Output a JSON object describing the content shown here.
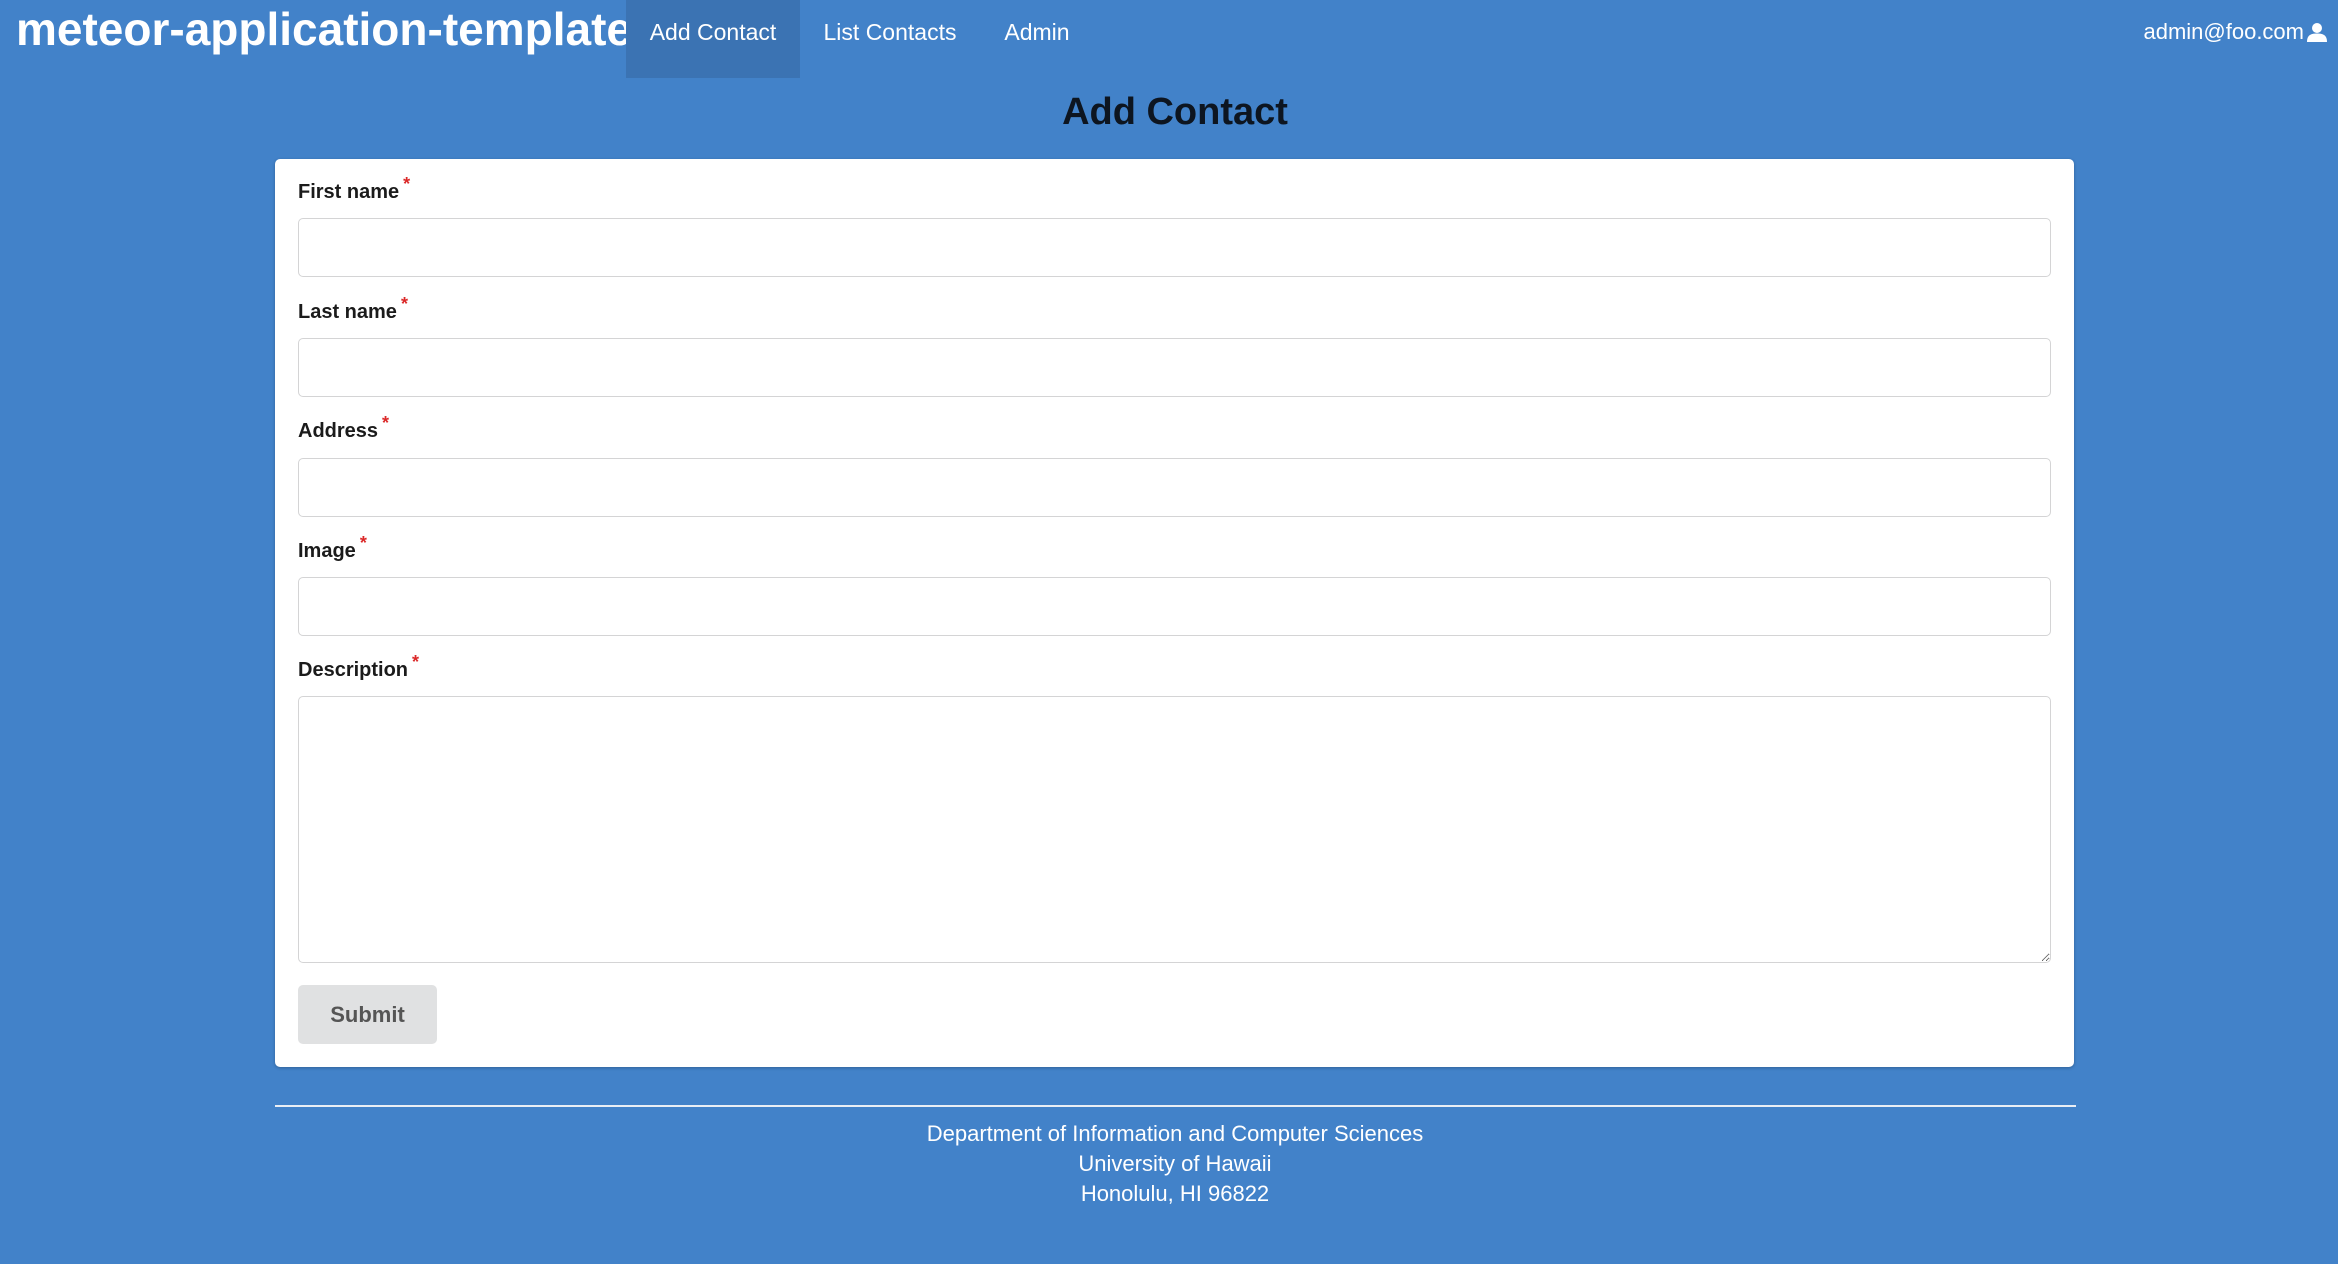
{
  "navbar": {
    "brand": "meteor-application-template",
    "items": [
      {
        "label": "Add Contact",
        "active": true
      },
      {
        "label": "List Contacts",
        "active": false
      },
      {
        "label": "Admin",
        "active": false
      }
    ],
    "user": {
      "email": "admin@foo.com",
      "icon": "user-icon"
    }
  },
  "page": {
    "title": "Add Contact"
  },
  "form": {
    "required_marker": "*",
    "fields": [
      {
        "label": "First name",
        "value": "",
        "required": true
      },
      {
        "label": "Last name",
        "value": "",
        "required": true
      },
      {
        "label": "Address",
        "value": "",
        "required": true
      },
      {
        "label": "Image",
        "value": "",
        "required": true
      },
      {
        "label": "Description",
        "value": "",
        "required": true,
        "multiline": true
      }
    ],
    "submit_label": "Submit"
  },
  "footer": {
    "lines": [
      "Department of Information and Computer Sciences",
      "University of Hawaii",
      "Honolulu, HI 96822"
    ]
  },
  "colors": {
    "background": "#4282c9",
    "active_nav": "#3b73b3",
    "required_marker": "#db2828",
    "button": "#e0e1e2"
  }
}
